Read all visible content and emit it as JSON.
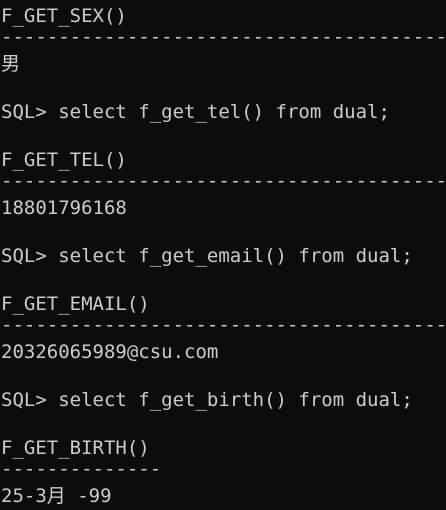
{
  "terminal": {
    "colors": {
      "background": "#0c0c0c",
      "text": "#cccccc"
    },
    "lines": {
      "col_sex": "F_GET_SEX()",
      "sep_long_1": "-----------------------------------------",
      "val_sex": "男",
      "cmd_tel": "SQL> select f_get_tel() from dual;",
      "col_tel": "F_GET_TEL()",
      "sep_long_2": "-----------------------------------------",
      "val_tel": "18801796168",
      "cmd_email": "SQL> select f_get_email() from dual;",
      "col_email": "F_GET_EMAIL()",
      "sep_long_3": "-----------------------------------------",
      "val_email": "20326065989@csu.com",
      "cmd_birth": "SQL> select f_get_birth() from dual;",
      "col_birth": "F_GET_BIRTH()",
      "sep_short": "--------------",
      "val_birth": "25-3月 -99"
    }
  }
}
